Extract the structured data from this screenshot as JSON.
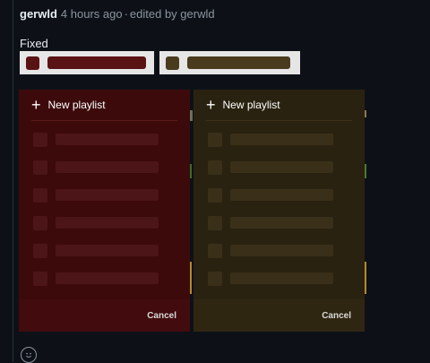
{
  "comment": {
    "author": "gerwld",
    "timestamp": "4 hours ago",
    "separator": "·",
    "edited": "edited by gerwld",
    "label": "Fixed"
  },
  "icons": {
    "add": "plus-icon",
    "reaction": "smiley-icon"
  },
  "colors": {
    "page_bg": "#0d1117",
    "swatch_bg": "#e6e6e6",
    "red_dark": "#5a1315",
    "red_panel": "#3d0a0c",
    "red_foot": "#420b0d",
    "olive_dark": "#4a3b1e",
    "olive_panel": "#2a2210",
    "olive_foot": "#2f2612"
  },
  "panels": [
    {
      "id": "red",
      "new_playlist": "New playlist",
      "cancel": "Cancel"
    },
    {
      "id": "olive",
      "new_playlist": "New playlist",
      "cancel": "Cancel"
    }
  ]
}
